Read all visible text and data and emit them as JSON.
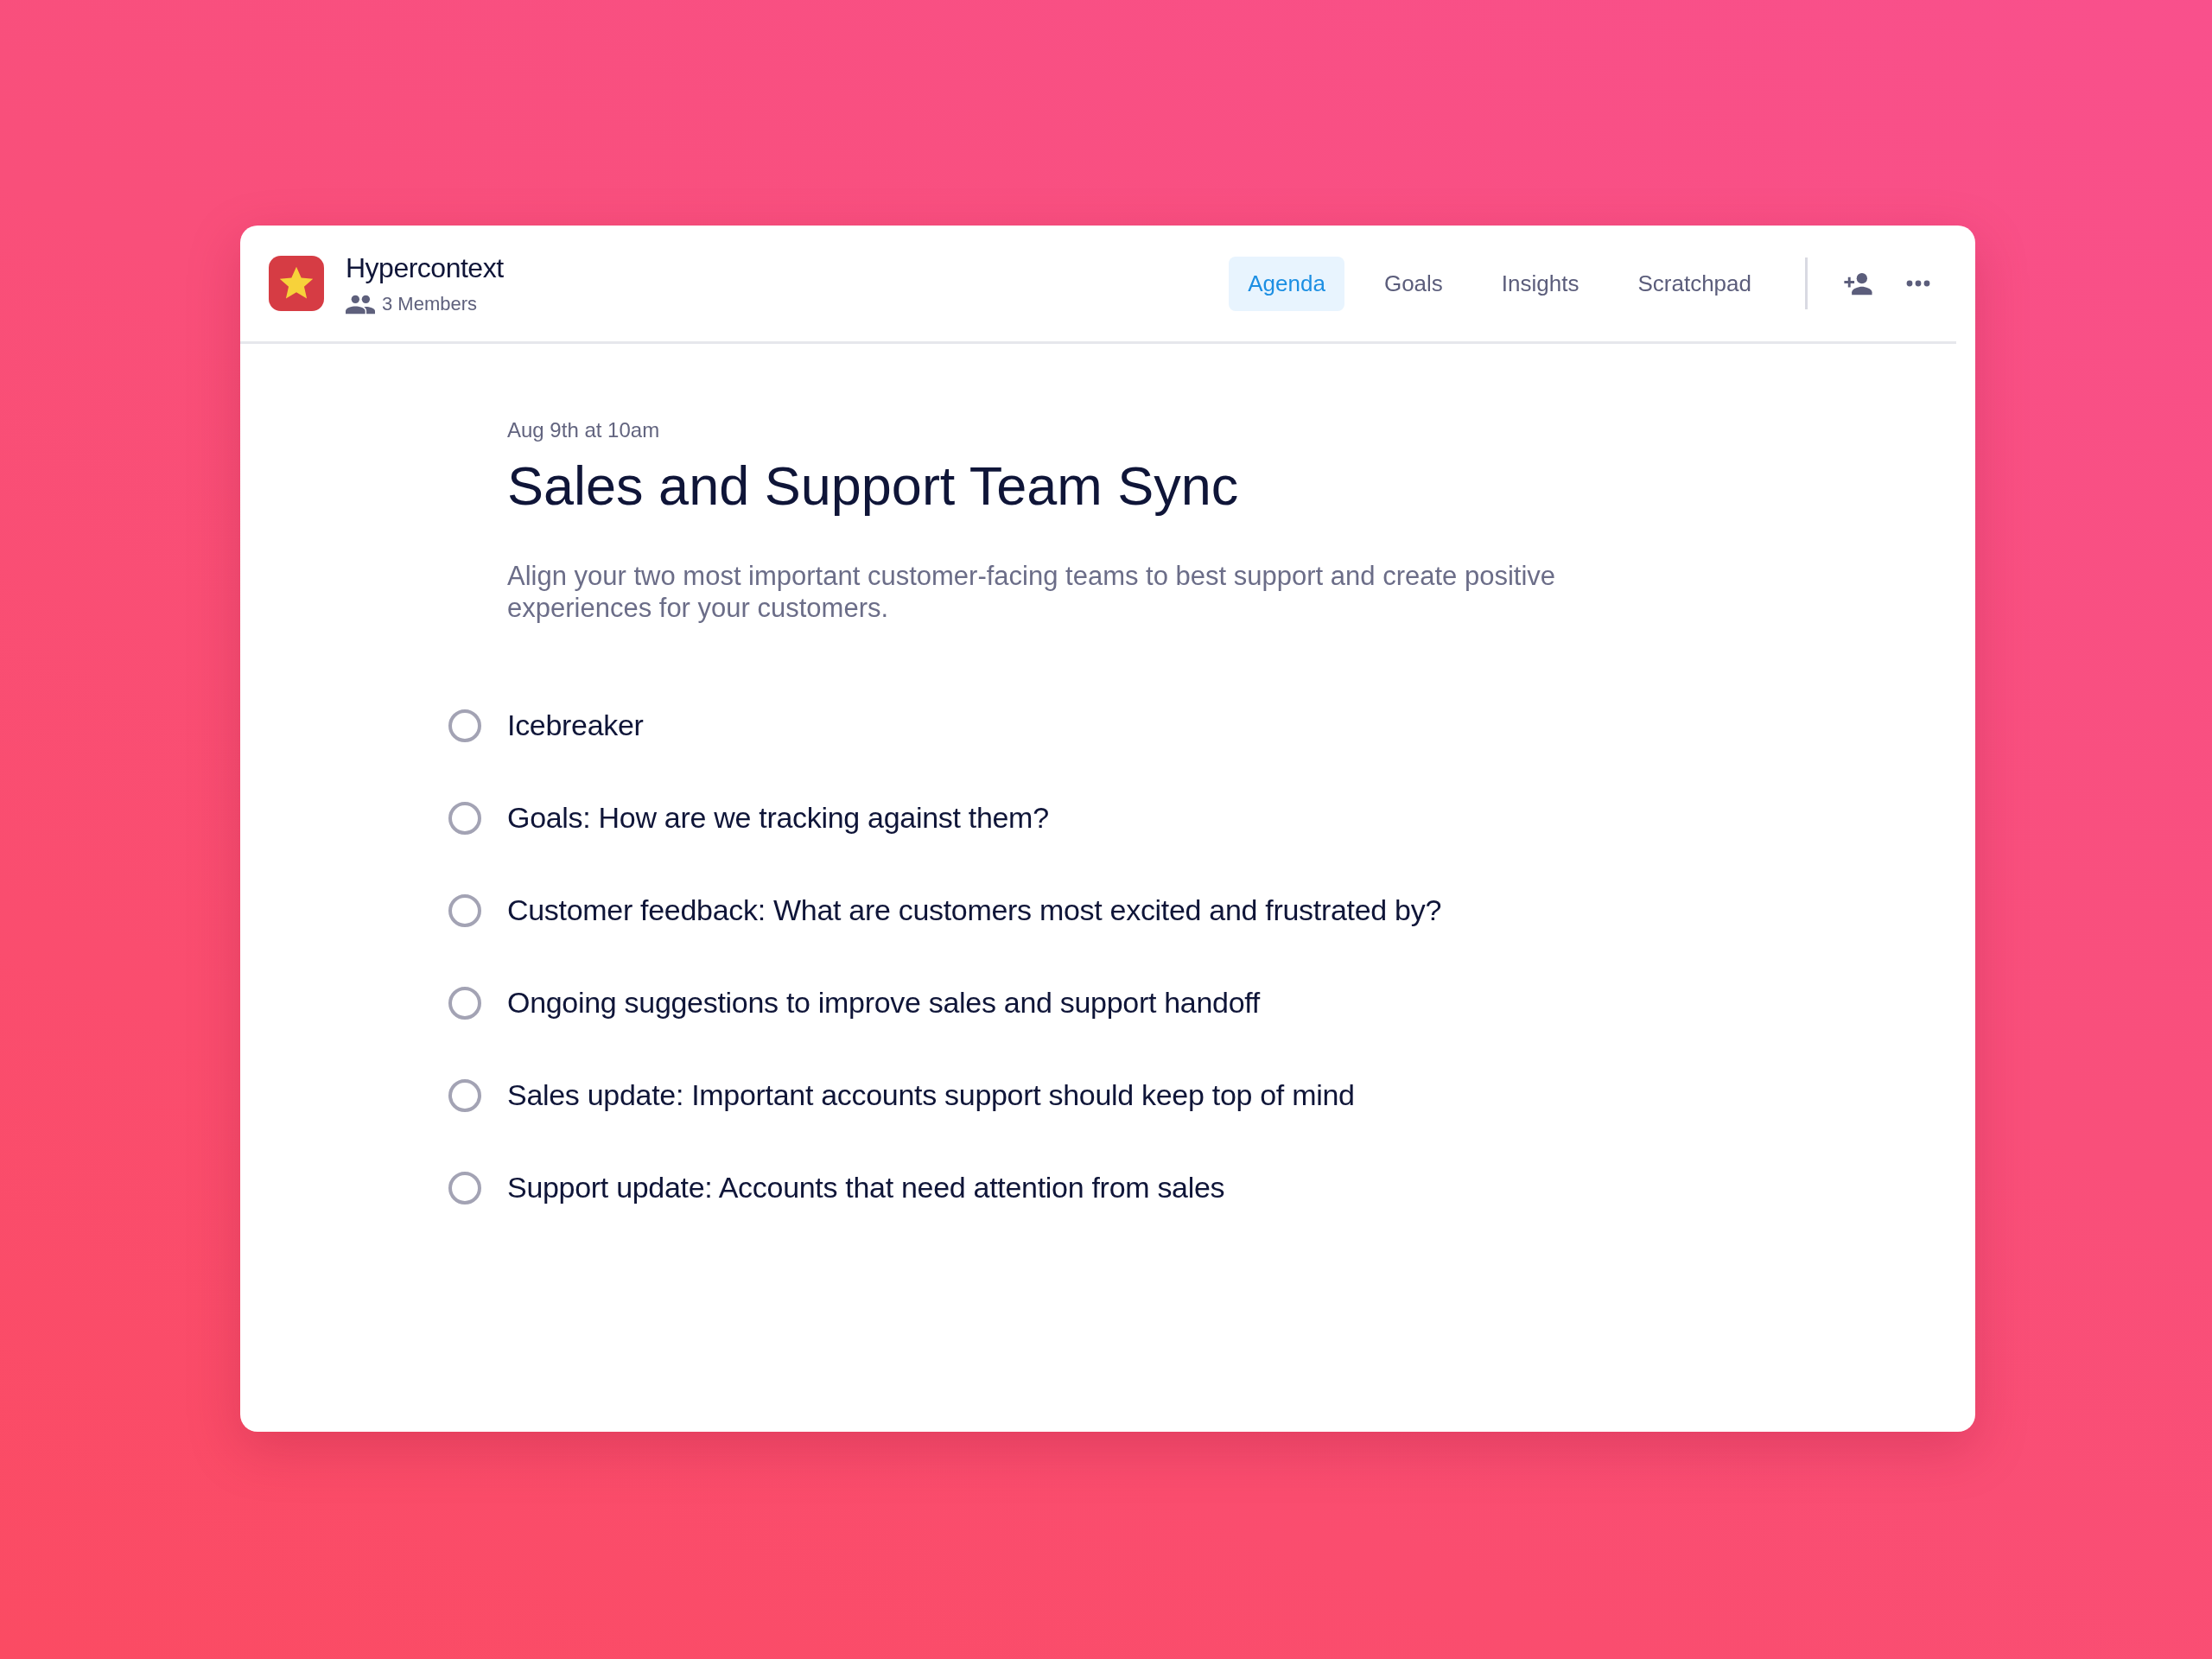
{
  "app": {
    "name": "Hypercontext",
    "members": "3 Members"
  },
  "tabs": [
    {
      "label": "Agenda",
      "selected": true
    },
    {
      "label": "Goals",
      "selected": false
    },
    {
      "label": "Insights",
      "selected": false
    },
    {
      "label": "Scratchpad",
      "selected": false
    }
  ],
  "meeting": {
    "date": "Aug 9th at 10am",
    "title": "Sales and Support Team Sync",
    "description": "Align your two most important customer-facing teams to best support and create positive experiences for your customers."
  },
  "agenda": [
    {
      "text": "Icebreaker",
      "checked": false
    },
    {
      "text": "Goals: How are we tracking against them?",
      "checked": false
    },
    {
      "text": "Customer feedback: What are customers most excited and frustrated by?",
      "checked": false
    },
    {
      "text": "Ongoing suggestions to improve sales and support handoff",
      "checked": false
    },
    {
      "text": "Sales update: Important accounts support should keep top of mind",
      "checked": false
    },
    {
      "text": "Support update: Accounts that need attention from sales",
      "checked": false
    }
  ]
}
